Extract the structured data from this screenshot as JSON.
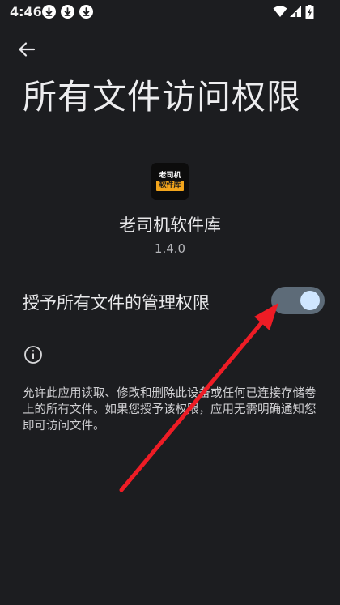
{
  "status_bar": {
    "time": "4:46",
    "icons": [
      "download-icon",
      "download-icon",
      "download-icon",
      "wifi-icon",
      "signal-icon",
      "battery-charging-icon"
    ]
  },
  "header": {
    "back_icon": "arrow-back-icon",
    "title": "所有文件访问权限"
  },
  "app": {
    "icon_text_line1": "老司机",
    "icon_text_line2": "软件库",
    "name": "老司机软件库",
    "version": "1.4.0"
  },
  "permission": {
    "label": "授予所有文件的管理权限",
    "enabled": true
  },
  "info": {
    "icon": "info-icon",
    "description": "允许此应用读取、修改和删除此设备或任何已连接存储卷上的所有文件。如果您授予该权限，应用无需明确通知您即可访问文件。"
  },
  "colors": {
    "background": "#1c1d20",
    "toggle_track": "#5d6b78",
    "toggle_thumb": "#cfe6ff",
    "annotation_arrow": "#ee1c25",
    "app_icon_accent": "#f2a51c"
  }
}
